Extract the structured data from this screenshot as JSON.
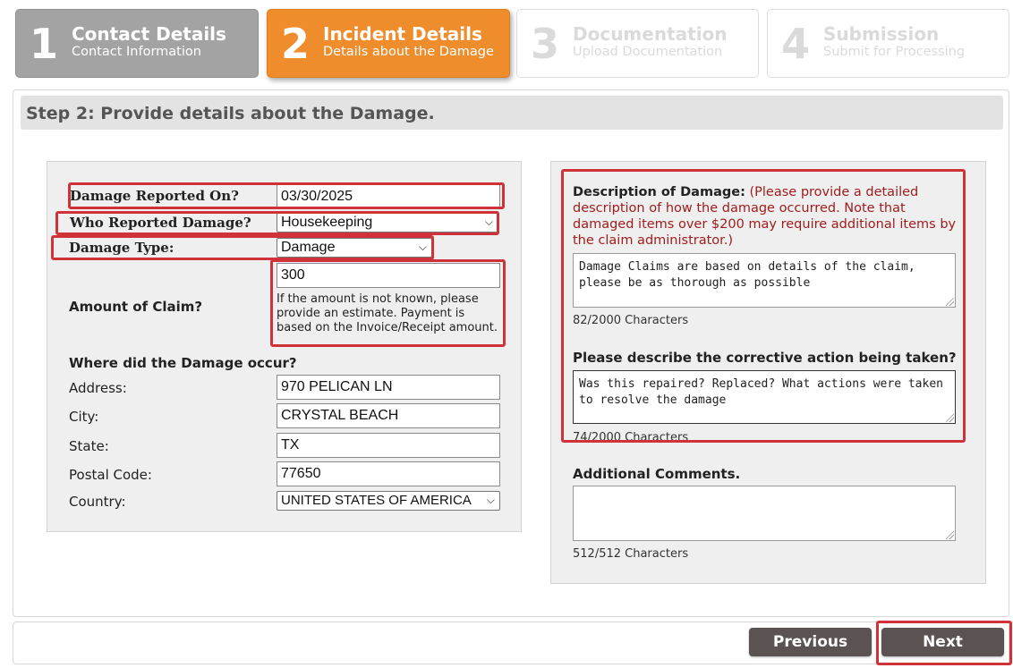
{
  "steps": [
    {
      "num": "1",
      "title": "Contact Details",
      "sub": "Contact Information"
    },
    {
      "num": "2",
      "title": "Incident Details",
      "sub": "Details about the Damage"
    },
    {
      "num": "3",
      "title": "Documentation",
      "sub": "Upload Documentation"
    },
    {
      "num": "4",
      "title": "Submission",
      "sub": "Submit for Processing"
    }
  ],
  "header": "Step 2: Provide details about the Damage.",
  "form": {
    "reported_on_label": "Damage Reported On?",
    "reported_on_value": "03/30/2025",
    "who_reported_label": "Who Reported Damage?",
    "who_reported_value": "Housekeeping",
    "damage_type_label": "Damage Type:",
    "damage_type_value": "Damage",
    "amount_label": "Amount of Claim?",
    "amount_value": "300",
    "amount_hint": "If the amount is not known, please provide an estimate. Payment is based on the Invoice/Receipt amount.",
    "where_label": "Where did the Damage occur?",
    "address_label": "Address:",
    "address_value": "970 PELICAN LN",
    "city_label": "City:",
    "city_value": "CRYSTAL BEACH",
    "state_label": "State:",
    "state_value": "TX",
    "postal_label": "Postal Code:",
    "postal_value": "77650",
    "country_label": "Country:",
    "country_value": "UNITED STATES OF AMERICA"
  },
  "right": {
    "desc_label": "Description of Damage:",
    "desc_help": "(Please provide a detailed description of how the damage occurred. Note that damaged items over $200 may require additional items by the claim administrator.)",
    "desc_text": "Damage Claims are based on details of the claim, please be as thorough as possible",
    "desc_count": "82/2000 Characters",
    "corrective_label": "Please describe the corrective action being taken?",
    "corrective_text": "Was this repaired? Replaced? What actions were taken to resolve the damage",
    "corrective_count": "74/2000 Characters",
    "comments_label": "Additional Comments.",
    "comments_text": "",
    "comments_count": "512/512 Characters"
  },
  "buttons": {
    "previous": "Previous",
    "next": "Next"
  },
  "colors": {
    "active_step": "#ef8c2b",
    "done_step": "#a3a3a3",
    "highlight": "#d0323a",
    "button": "#5a5352",
    "help_text": "#a11d1d"
  }
}
